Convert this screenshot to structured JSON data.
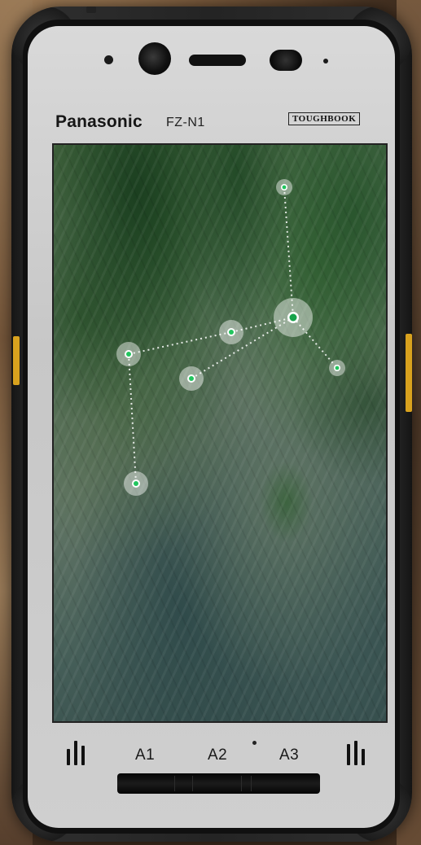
{
  "device": {
    "brand": "Panasonic",
    "model": "FZ-N1",
    "series_badge": "TOUGHBOOK",
    "colors": {
      "body": "#222222",
      "faceplate": "#cfcfcf",
      "accent_buttons": "#d9a21e"
    }
  },
  "screen": {
    "content": "aerial-terrain-with-waypoints",
    "waypoint_color": "#22c55e",
    "link_style": "dotted-white"
  },
  "bottom_keys": {
    "a1": "A1",
    "a2": "A2",
    "a3": "A3",
    "left_icon": "recent-apps-icon",
    "right_icon": "recent-apps-icon"
  }
}
